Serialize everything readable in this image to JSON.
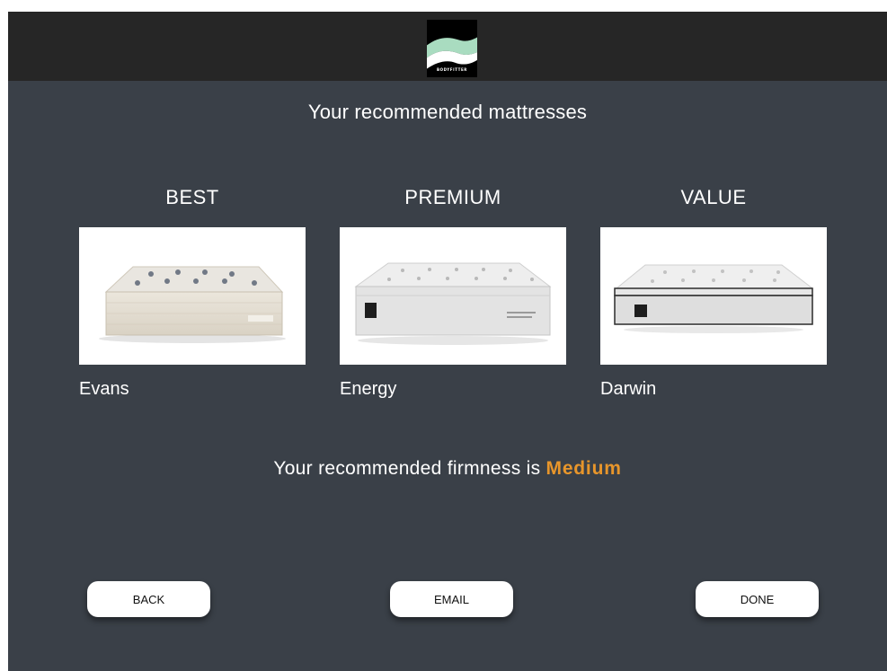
{
  "header": {
    "logo_icon": "bodyfitter-wave-logo",
    "logo_text": "BODYFITTER",
    "colors": {
      "bar": "#262626",
      "background": "#3a4048"
    }
  },
  "title": "Your recommended mattresses",
  "recommendations": [
    {
      "tier": "BEST",
      "name": "Evans",
      "image_icon": "mattress-evans-image"
    },
    {
      "tier": "PREMIUM",
      "name": "Energy",
      "image_icon": "mattress-energy-image"
    },
    {
      "tier": "VALUE",
      "name": "Darwin",
      "image_icon": "mattress-darwin-image"
    }
  ],
  "firmness": {
    "prefix": "Your recommended firmness is",
    "value": "Medium",
    "accent_color": "#e8962b"
  },
  "buttons": {
    "back": "BACK",
    "email": "EMAIL",
    "done": "DONE"
  }
}
